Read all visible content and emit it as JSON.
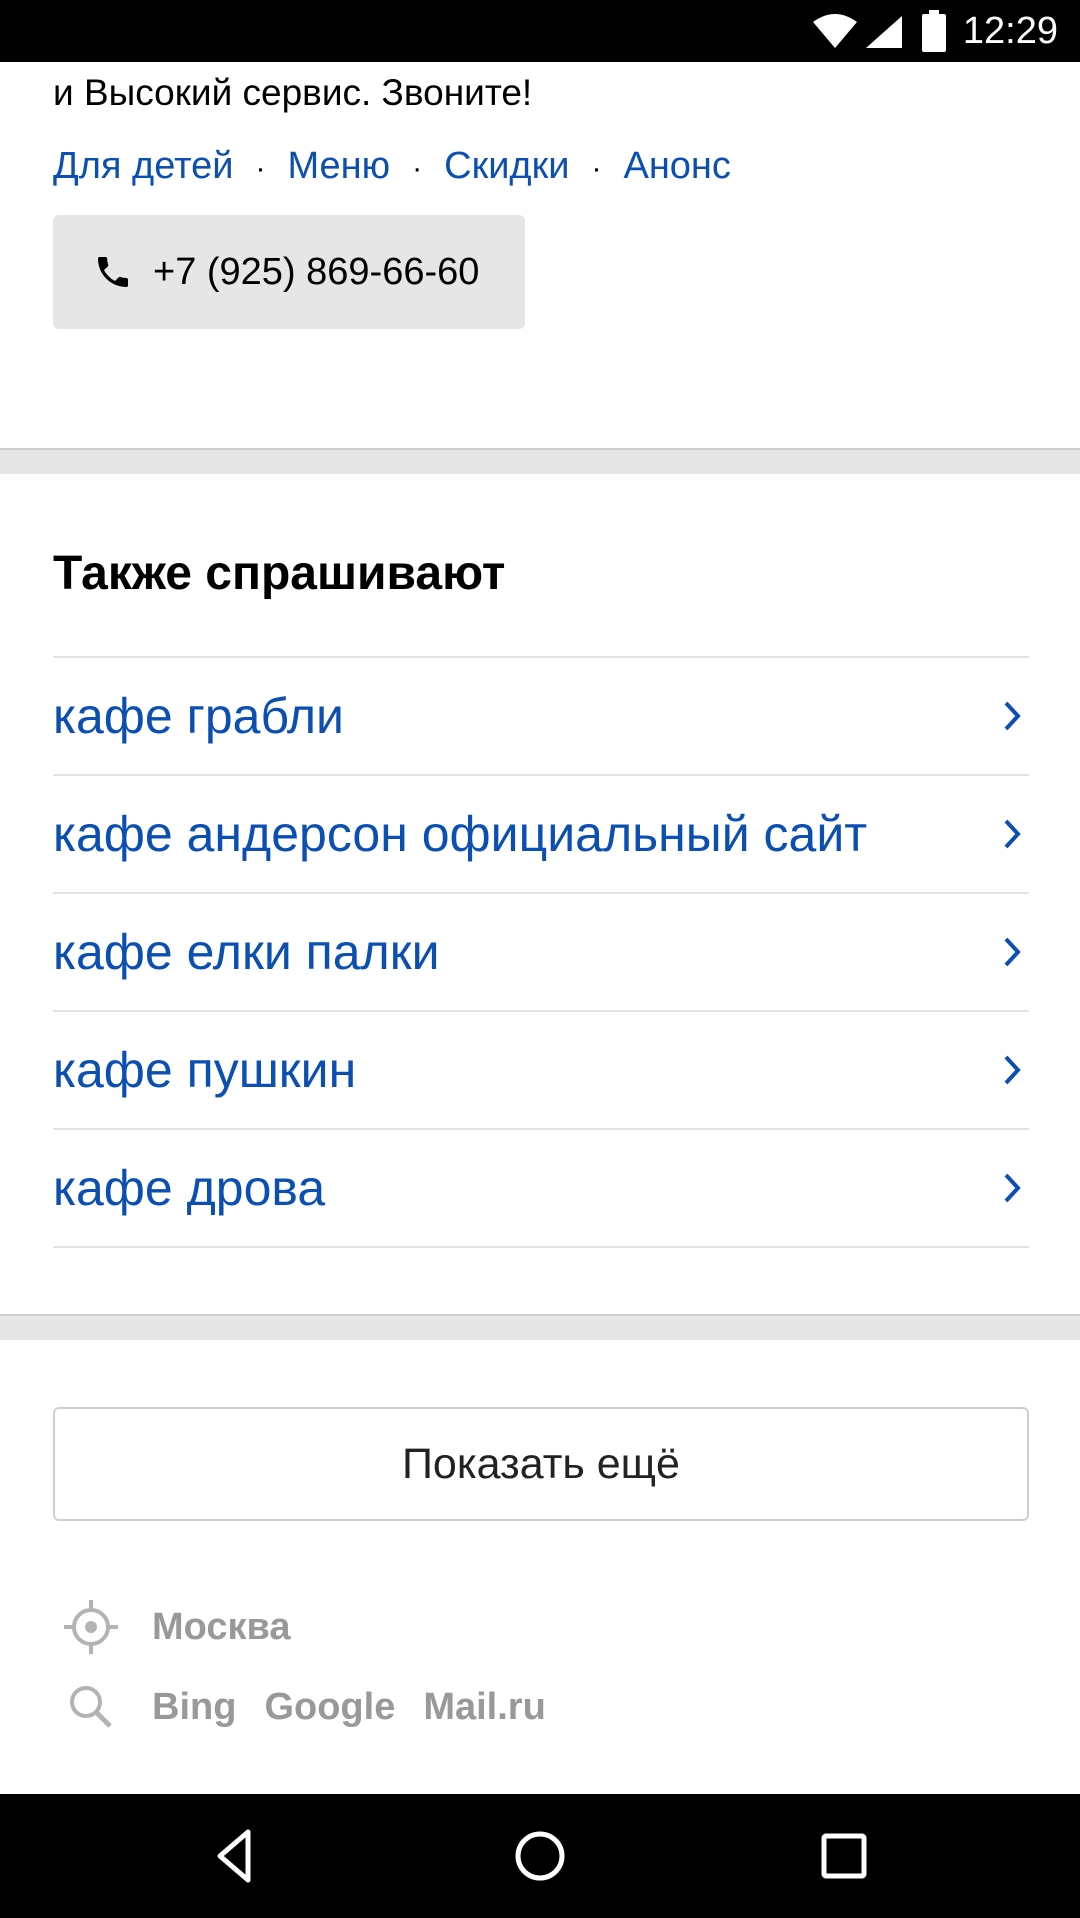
{
  "status_bar": {
    "time": "12:29",
    "icons": [
      "wifi-icon",
      "signal-icon",
      "battery-icon"
    ]
  },
  "snippet": {
    "text_tail": "и Высокий сервис. Звоните!",
    "sitelinks": [
      "Для детей",
      "Меню",
      "Скидки",
      "Анонс"
    ],
    "separator": "·",
    "phone": "+7 (925) 869-66-60",
    "phone_icon": "phone-icon"
  },
  "also_asked": {
    "title": "Также спрашивают",
    "items": [
      "кафе грабли",
      "кафе андерсон официальный сайт",
      "кафе елки палки",
      "кафе пушкин",
      "кафе дрова"
    ],
    "item_icon": "chevron-right-icon"
  },
  "show_more": {
    "label": "Показать ещё"
  },
  "footer": {
    "region": "Москва",
    "region_icon": "location-icon",
    "search_icon": "search-icon",
    "engines": [
      "Bing",
      "Google",
      "Mail.ru"
    ]
  },
  "nav_bar": {
    "buttons": [
      "back-icon",
      "home-icon",
      "recents-icon"
    ]
  },
  "colors": {
    "link": "#0c4fb3",
    "footer_text": "#999999",
    "separator_bg": "#e6e6e6",
    "button_bg": "#e6e6e6"
  }
}
